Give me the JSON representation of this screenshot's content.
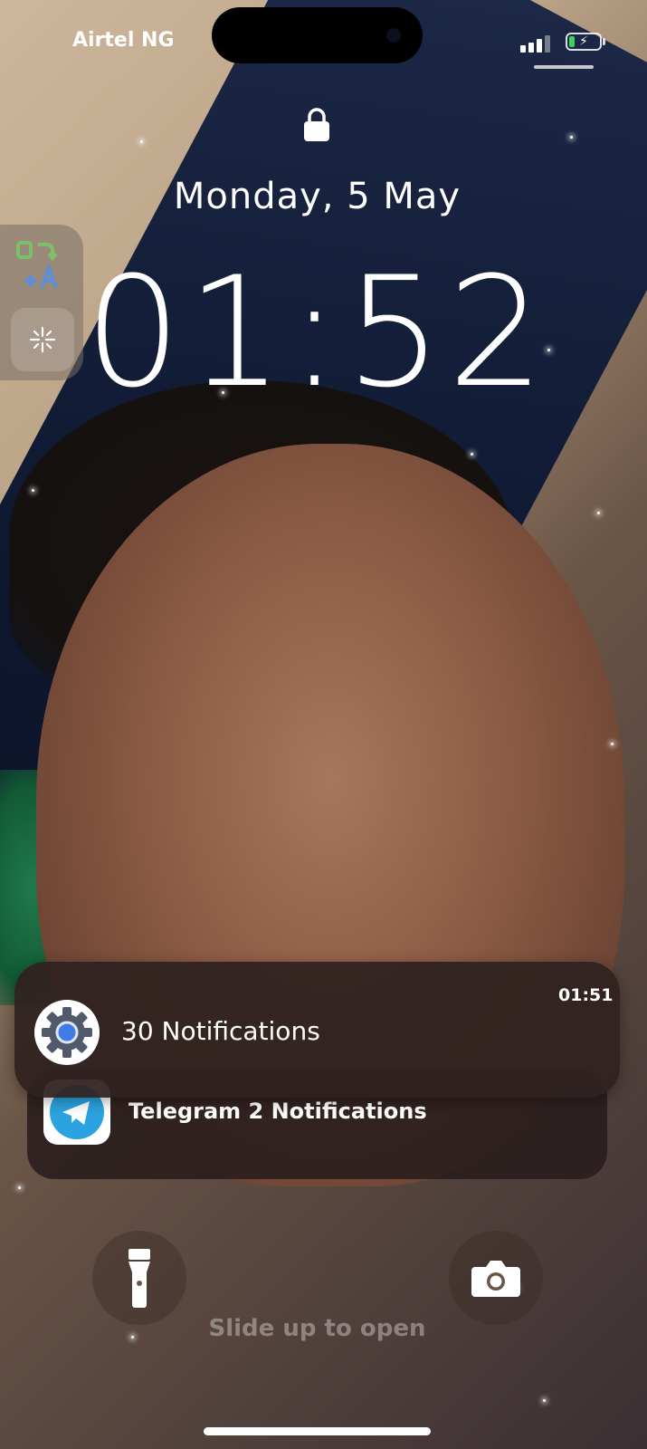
{
  "status_bar": {
    "carrier": "Airtel NG",
    "signal_bars_active": 3,
    "signal_bars_total": 4,
    "battery_level": 0.2,
    "battery_charging": true,
    "battery_bolt_glyph": "⚡",
    "battery_color": "#3bd35a"
  },
  "lock_screen": {
    "lock_icon": "lock-icon",
    "date": "Monday, 5 May",
    "time": "01:52"
  },
  "widgets": [
    {
      "icon": "translate-icon"
    },
    {
      "icon": "focus-sparkle-icon"
    }
  ],
  "notifications": {
    "front": {
      "app_icon": "settings-gear-icon",
      "title": "30 Notifications",
      "time": "01:51"
    },
    "back": {
      "app_icon": "telegram-icon",
      "title": "Telegram 2 Notifications",
      "icon_color": "#2aa3e0"
    }
  },
  "quick_actions": {
    "left_icon": "flashlight-icon",
    "right_icon": "camera-icon"
  },
  "slide_hint": "Slide up to open"
}
